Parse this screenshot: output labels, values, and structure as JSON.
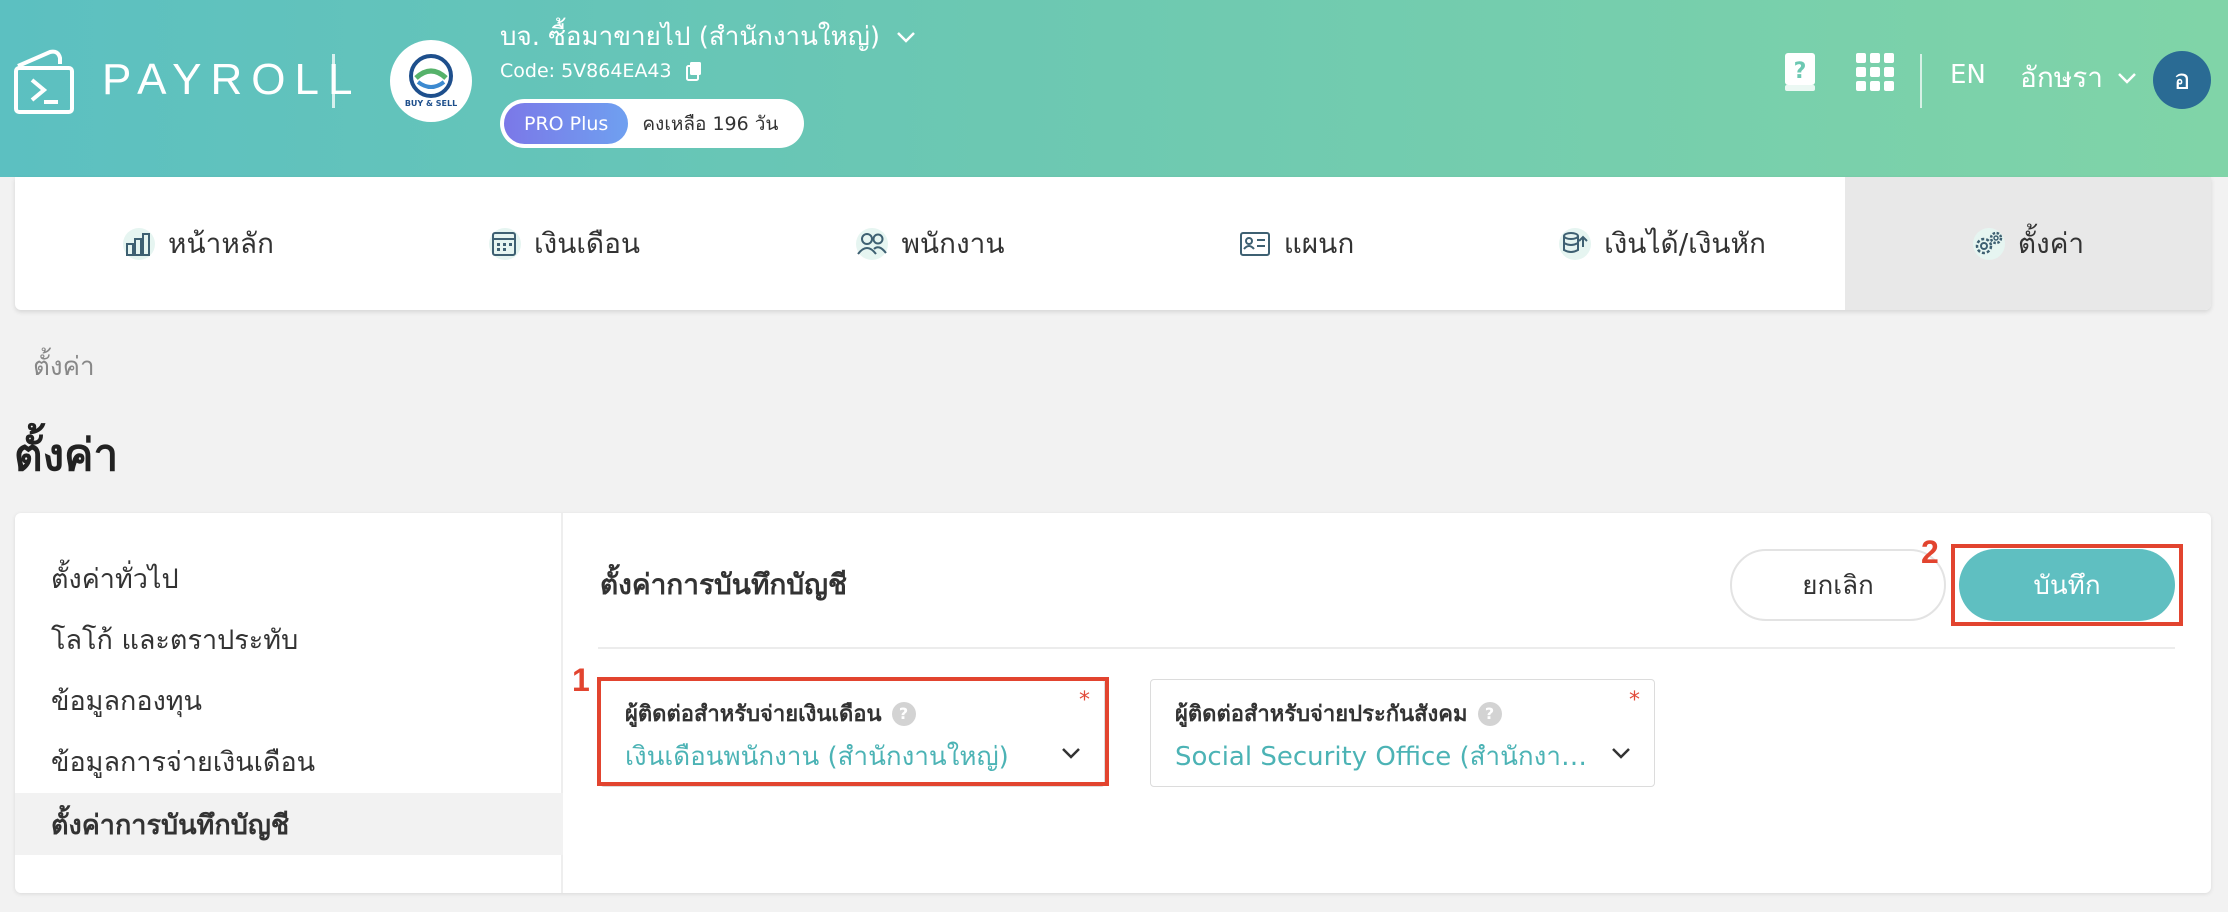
{
  "header": {
    "logo_text": "PAYROLL",
    "company_logo_caption": "BUY & SELL",
    "company_name": "บจ. ซื้อมาขายไป (สำนักงานใหญ่)",
    "company_code": "Code: 5V864EA43",
    "plan_badge": "PRO Plus",
    "plan_remaining": "คงเหลือ 196 วัน",
    "language": "EN",
    "user_name": "อักษรา",
    "avatar_initial": "อ",
    "icons": [
      "help-book-icon",
      "apps-grid-icon"
    ]
  },
  "nav": {
    "items": [
      {
        "label": "หน้าหลัก",
        "icon": "dashboard-chart-icon"
      },
      {
        "label": "เงินเดือน",
        "icon": "calendar-icon"
      },
      {
        "label": "พนักงาน",
        "icon": "people-icon"
      },
      {
        "label": "แผนก",
        "icon": "id-card-icon"
      },
      {
        "label": "เงินได้/เงินหัก",
        "icon": "coins-icon"
      },
      {
        "label": "ตั้งค่า",
        "icon": "gears-icon"
      }
    ],
    "active": "ตั้งค่า"
  },
  "breadcrumb": "ตั้งค่า",
  "page_title": "ตั้งค่า",
  "sidebar": {
    "items": [
      {
        "label": "ตั้งค่าทั่วไป"
      },
      {
        "label": "โลโก้ และตราประทับ"
      },
      {
        "label": "ข้อมูลกองทุน"
      },
      {
        "label": "ข้อมูลการจ่ายเงินเดือน"
      },
      {
        "label": "ตั้งค่าการบันทึกบัญชี"
      }
    ],
    "active": "ตั้งค่าการบันทึกบัญชี"
  },
  "section": {
    "title": "ตั้งค่าการบันทึกบัญชี",
    "cancel_label": "ยกเลิก",
    "save_label": "บันทึก"
  },
  "fields": [
    {
      "label": "ผู้ติดต่อสำหรับจ่ายเงินเดือน",
      "value": "เงินเดือนพนักงาน (สำนักงานใหญ่)",
      "required_mark": "*"
    },
    {
      "label": "ผู้ติดต่อสำหรับจ่ายประกันสังคม",
      "value": "Social Security Office (สำนักงานใหญ่)",
      "required_mark": "*"
    }
  ],
  "help_glyph": "?",
  "annotations": [
    "1",
    "2"
  ],
  "colors": {
    "header_gradient_start": "#5cc0c1",
    "header_gradient_end": "#80d4a8",
    "accent": "#5fbfc1",
    "value_text": "#4cb3b5",
    "annotation": "#e2442f",
    "plan_badge": "#7b78e8"
  }
}
